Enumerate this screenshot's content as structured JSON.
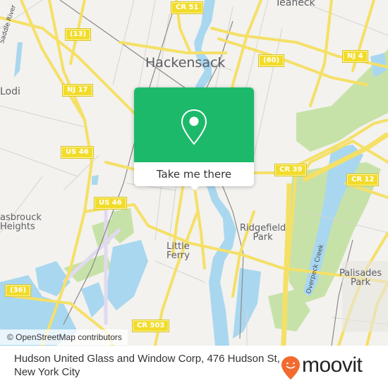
{
  "map": {
    "places": {
      "hackensack": "Hackensack",
      "teaneck": "Teaneck",
      "lodi": "Lodi",
      "hasbrouck_heights_line1": "asbrouck",
      "hasbrouck_heights_line2": "Heights",
      "ridgefield_park_line1": "Ridgefield",
      "ridgefield_park_line2": "Park",
      "little_ferry_line1": "Little",
      "little_ferry_line2": "Ferry",
      "palisades_park_line1": "Palisades",
      "palisades_park_line2": "Park"
    },
    "water_labels": {
      "saddle_river": "Saddle River",
      "overpeck_creek": "Overpeck Creek"
    },
    "route_shields": {
      "cr51": "CR 51",
      "r13": "(13)",
      "r60": "(60)",
      "nj4": "NJ 4",
      "nj17": "NJ 17",
      "us46_a": "US 46",
      "us46_b": "US 46",
      "cr39": "CR 39",
      "cr12": "CR 12",
      "r36": "(36)",
      "cr503": "CR 503"
    },
    "colors": {
      "land": "#f3f2ee",
      "water": "#a9d7ef",
      "park": "#c7e2a8",
      "road_major": "#f5e067",
      "road_minor": "#d6d4cf",
      "rail": "#8a8a8a",
      "airport": "#e6dff0"
    }
  },
  "popup": {
    "icon": "location-pin-icon",
    "cta_label": "Take me there",
    "accent_color": "#1db96a"
  },
  "attribution": "© OpenStreetMap contributors",
  "footer": {
    "title": "Hudson United Glass and Window Corp, 476 Hudson St, New York City",
    "brand": "moovit",
    "brand_icon": "moovit-pin-logo-icon",
    "brand_color": "#f26a2e"
  }
}
